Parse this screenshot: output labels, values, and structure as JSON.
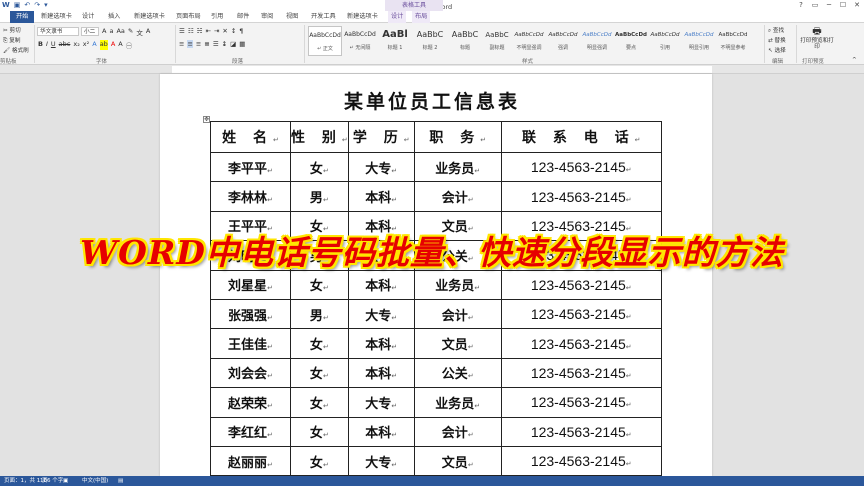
{
  "window": {
    "title": "文档2 - Word",
    "context_group": "表格工具",
    "controls": [
      "?",
      "▭",
      "─",
      "☐",
      "✕"
    ]
  },
  "tabs": [
    {
      "label": "开始",
      "active": true
    },
    {
      "label": "新建选项卡"
    },
    {
      "label": "设计"
    },
    {
      "label": "插入"
    },
    {
      "label": "新建选项卡"
    },
    {
      "label": "页面布局"
    },
    {
      "label": "引用"
    },
    {
      "label": "邮件"
    },
    {
      "label": "审阅"
    },
    {
      "label": "视图"
    },
    {
      "label": "开发工具"
    },
    {
      "label": "新建选项卡"
    },
    {
      "label": "设计",
      "context": true
    },
    {
      "label": "布局",
      "context": true
    }
  ],
  "ribbon": {
    "clipboard": {
      "cut": "剪切",
      "copy": "复制",
      "format_painter": "格式刷",
      "group": "剪贴板"
    },
    "font": {
      "name": "华文隶书",
      "size": "小二",
      "group": "字体"
    },
    "paragraph": {
      "group": "段落"
    },
    "styles": {
      "group": "样式",
      "items": [
        {
          "sample": "AaBbCcDd",
          "name": "↵ 正文",
          "selected": true
        },
        {
          "sample": "AaBbCcDd",
          "name": "↵ 无间隔"
        },
        {
          "sample": "AaBl",
          "name": "标题 1"
        },
        {
          "sample": "AaBbC",
          "name": "标题 2"
        },
        {
          "sample": "AaBbC",
          "name": "标题"
        },
        {
          "sample": "AaBbC",
          "name": "副标题"
        },
        {
          "sample": "AaBbCcDd",
          "name": "不明显强调"
        },
        {
          "sample": "AaBbCcDd",
          "name": "强调"
        },
        {
          "sample": "AaBbCcDd",
          "name": "明显强调"
        },
        {
          "sample": "AaBbCcDd",
          "name": "要点"
        },
        {
          "sample": "AaBbCcDd",
          "name": "引用"
        },
        {
          "sample": "AaBbCcDd",
          "name": "明显引用"
        },
        {
          "sample": "AaBbCcDd",
          "name": "不明显参考"
        }
      ]
    },
    "editing": {
      "find": "查找",
      "replace": "替换",
      "select": "选择",
      "group": "编辑"
    },
    "print_preview": {
      "label": "打印预览和打印",
      "group": "打印预览"
    }
  },
  "document": {
    "title": "某单位员工信息表",
    "table": {
      "headers": [
        "姓 名",
        "性 别",
        "学 历",
        "职 务",
        "联 系 电 话"
      ],
      "rows": [
        [
          "李平平",
          "女",
          "大专",
          "业务员",
          "123-4563-2145"
        ],
        [
          "李林林",
          "男",
          "本科",
          "会计",
          "123-4563-2145"
        ],
        [
          "王平平",
          "女",
          "本科",
          "文员",
          "123-4563-2145"
        ],
        [
          "刘明明",
          "男",
          "大专",
          "公关",
          "123-4563-2145"
        ],
        [
          "刘星星",
          "女",
          "本科",
          "业务员",
          "123-4563-2145"
        ],
        [
          "张强强",
          "男",
          "大专",
          "会计",
          "123-4563-2145"
        ],
        [
          "王佳佳",
          "女",
          "本科",
          "文员",
          "123-4563-2145"
        ],
        [
          "刘会会",
          "女",
          "本科",
          "公关",
          "123-4563-2145"
        ],
        [
          "赵荣荣",
          "女",
          "大专",
          "业务员",
          "123-4563-2145"
        ],
        [
          "李红红",
          "女",
          "本科",
          "会计",
          "123-4563-2145"
        ],
        [
          "赵丽丽",
          "女",
          "大专",
          "文员",
          "123-4563-2145"
        ]
      ]
    }
  },
  "overlay_banner": "WORD中电话号码批量、快速分段显示的方法",
  "status": {
    "page": "页面：1，共 1 页",
    "words": "186 个字",
    "language": "中文(中国)"
  }
}
